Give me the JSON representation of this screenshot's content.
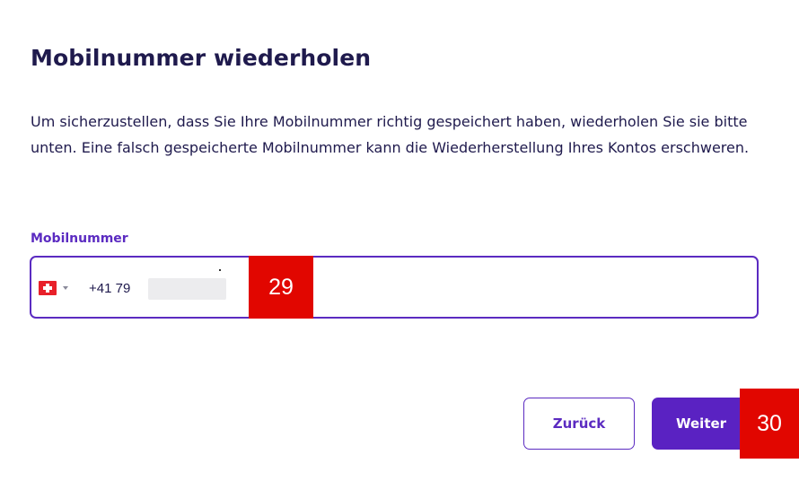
{
  "page": {
    "title": "Mobilnummer wiederholen",
    "intro": "Um sicherzustellen, dass Sie Ihre Mobilnummer richtig gespeichert haben, wiederholen Sie sie bitte unten. Eine falsch gespeicherte Mobilnummer kann die Wiederherstellung Ihres Kontos erschweren."
  },
  "phone_field": {
    "label": "Mobilnummer",
    "country_flag_icon": "swiss-flag-icon",
    "value": "+41 79"
  },
  "markers": {
    "field_marker": "29",
    "next_marker": "30"
  },
  "buttons": {
    "back_label": "Zurück",
    "next_label": "Weiter"
  },
  "colors": {
    "accent": "#5b2bc1",
    "primary_button": "#5a22c2",
    "text": "#1f1a4d",
    "marker": "#e10600"
  }
}
